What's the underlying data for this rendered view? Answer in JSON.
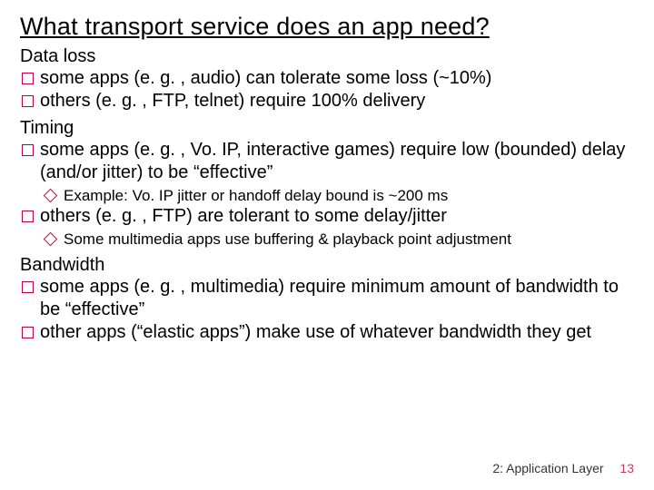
{
  "title": "What transport service does an app need?",
  "sections": {
    "dataloss": {
      "label": "Data loss",
      "b1": "some apps (e. g. , audio) can tolerate some loss (~10%)",
      "b2": "others (e. g. , FTP, telnet) require 100% delivery"
    },
    "timing": {
      "label": "Timing",
      "b1": "some apps (e. g. , Vo. IP, interactive games) require low (bounded) delay (and/or jitter) to be “effective”",
      "s1": "Example: Vo. IP jitter or handoff delay bound is ~200 ms",
      "b2": "others (e. g. , FTP) are tolerant to some delay/jitter",
      "s2": "Some multimedia apps use buffering & playback point adjustment"
    },
    "bandwidth": {
      "label": "Bandwidth",
      "b1": "some apps (e. g. , multimedia) require minimum amount of bandwidth to be “effective”",
      "b2": "other apps (“elastic apps”) make use of whatever bandwidth they get"
    }
  },
  "footer": {
    "chapter": "2: Application Layer",
    "page": "13"
  }
}
